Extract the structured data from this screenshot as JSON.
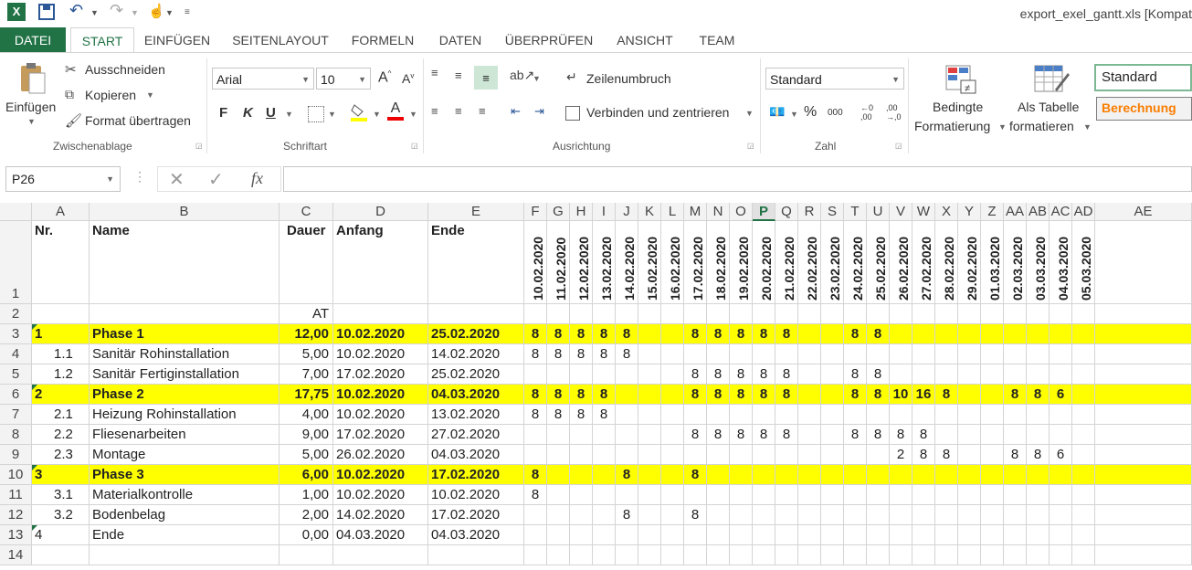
{
  "window": {
    "title": "export_exel_gantt.xls  [Kompat"
  },
  "quick_access": {
    "icons": [
      "excel-logo-icon",
      "save-icon",
      "undo-icon",
      "redo-icon",
      "touch-mode-icon",
      "customize-icon"
    ]
  },
  "tabs": [
    {
      "label": "DATEI"
    },
    {
      "label": "START"
    },
    {
      "label": "EINFÜGEN"
    },
    {
      "label": "SEITENLAYOUT"
    },
    {
      "label": "FORMELN"
    },
    {
      "label": "DATEN"
    },
    {
      "label": "ÜBERPRÜFEN"
    },
    {
      "label": "ANSICHT"
    },
    {
      "label": "TEAM"
    }
  ],
  "ribbon": {
    "clipboard": {
      "paste_label": "Einfügen",
      "cut_label": "Ausschneiden",
      "copy_label": "Kopieren",
      "format_painter_label": "Format übertragen",
      "group_label": "Zwischenablage"
    },
    "font": {
      "font_name": "Arial",
      "font_size": "10",
      "bold_label": "F",
      "italic_label": "K",
      "underline_label": "U",
      "group_label": "Schriftart"
    },
    "alignment": {
      "wrap_label": "Zeilenumbruch",
      "merge_label": "Verbinden und zentrieren",
      "group_label": "Ausrichtung"
    },
    "number": {
      "format": "Standard",
      "group_label": "Zahl"
    },
    "styles": {
      "conditional_label_1": "Bedingte",
      "conditional_label_2": "Formatierung",
      "table_label_1": "Als Tabelle",
      "table_label_2": "formatieren",
      "style_standard": "Standard",
      "style_calc": "Berechnung"
    }
  },
  "formula_bar": {
    "name_box": "P26",
    "fx": "fx",
    "formula": ""
  },
  "columns": [
    "A",
    "B",
    "C",
    "D",
    "E",
    "F",
    "G",
    "H",
    "I",
    "J",
    "K",
    "L",
    "M",
    "N",
    "O",
    "P",
    "Q",
    "R",
    "S",
    "T",
    "U",
    "V",
    "W",
    "X",
    "Y",
    "Z",
    "AA",
    "AB",
    "AC",
    "AD",
    "AE"
  ],
  "selected_column": "P",
  "headers": {
    "nr": "Nr.",
    "name": "Name",
    "dauer": "Dauer",
    "anfang": "Anfang",
    "ende": "Ende",
    "unit": "AT",
    "dates": [
      "10.02.2020",
      "11.02.2020",
      "12.02.2020",
      "13.02.2020",
      "14.02.2020",
      "15.02.2020",
      "16.02.2020",
      "17.02.2020",
      "18.02.2020",
      "19.02.2020",
      "20.02.2020",
      "21.02.2020",
      "22.02.2020",
      "23.02.2020",
      "24.02.2020",
      "25.02.2020",
      "26.02.2020",
      "27.02.2020",
      "28.02.2020",
      "29.02.2020",
      "01.03.2020",
      "02.03.2020",
      "03.03.2020",
      "04.03.2020",
      "05.03.2020"
    ]
  },
  "rows": [
    {
      "num": "3",
      "nr": "1",
      "name": "Phase 1",
      "dauer": "12,00",
      "anfang": "10.02.2020",
      "ende": "25.02.2020",
      "phase": true,
      "hours": [
        "8",
        "8",
        "8",
        "8",
        "8",
        "",
        "",
        "8",
        "8",
        "8",
        "8",
        "8",
        "",
        "",
        "8",
        "8",
        "",
        "",
        "",
        "",
        "",
        "",
        "",
        "",
        ""
      ]
    },
    {
      "num": "4",
      "nr": "1.1",
      "name": "Sanitär Rohinstallation",
      "dauer": "5,00",
      "anfang": "10.02.2020",
      "ende": "14.02.2020",
      "phase": false,
      "hours": [
        "8",
        "8",
        "8",
        "8",
        "8",
        "",
        "",
        "",
        "",
        "",
        "",
        "",
        "",
        "",
        "",
        "",
        "",
        "",
        "",
        "",
        "",
        "",
        "",
        "",
        ""
      ]
    },
    {
      "num": "5",
      "nr": "1.2",
      "name": "Sanitär Fertiginstallation",
      "dauer": "7,00",
      "anfang": "17.02.2020",
      "ende": "25.02.2020",
      "phase": false,
      "hours": [
        "",
        "",
        "",
        "",
        "",
        "",
        "",
        "8",
        "8",
        "8",
        "8",
        "8",
        "",
        "",
        "8",
        "8",
        "",
        "",
        "",
        "",
        "",
        "",
        "",
        "",
        ""
      ]
    },
    {
      "num": "6",
      "nr": "2",
      "name": "Phase 2",
      "dauer": "17,75",
      "anfang": "10.02.2020",
      "ende": "04.03.2020",
      "phase": true,
      "hours": [
        "8",
        "8",
        "8",
        "8",
        "",
        "",
        "",
        "8",
        "8",
        "8",
        "8",
        "8",
        "",
        "",
        "8",
        "8",
        "10",
        "16",
        "8",
        "",
        "",
        "8",
        "8",
        "6",
        ""
      ]
    },
    {
      "num": "7",
      "nr": "2.1",
      "name": "Heizung Rohinstallation",
      "dauer": "4,00",
      "anfang": "10.02.2020",
      "ende": "13.02.2020",
      "phase": false,
      "hours": [
        "8",
        "8",
        "8",
        "8",
        "",
        "",
        "",
        "",
        "",
        "",
        "",
        "",
        "",
        "",
        "",
        "",
        "",
        "",
        "",
        "",
        "",
        "",
        "",
        "",
        ""
      ]
    },
    {
      "num": "8",
      "nr": "2.2",
      "name": "Fliesenarbeiten",
      "dauer": "9,00",
      "anfang": "17.02.2020",
      "ende": "27.02.2020",
      "phase": false,
      "hours": [
        "",
        "",
        "",
        "",
        "",
        "",
        "",
        "8",
        "8",
        "8",
        "8",
        "8",
        "",
        "",
        "8",
        "8",
        "8",
        "8",
        "",
        "",
        "",
        "",
        "",
        "",
        ""
      ]
    },
    {
      "num": "9",
      "nr": "2.3",
      "name": "Montage",
      "dauer": "5,00",
      "anfang": "26.02.2020",
      "ende": "04.03.2020",
      "phase": false,
      "hours": [
        "",
        "",
        "",
        "",
        "",
        "",
        "",
        "",
        "",
        "",
        "",
        "",
        "",
        "",
        "",
        "",
        "2",
        "8",
        "8",
        "",
        "",
        "8",
        "8",
        "6",
        ""
      ]
    },
    {
      "num": "10",
      "nr": "3",
      "name": "Phase 3",
      "dauer": "6,00",
      "anfang": "10.02.2020",
      "ende": "17.02.2020",
      "phase": true,
      "hours": [
        "8",
        "",
        "",
        "",
        "8",
        "",
        "",
        "8",
        "",
        "",
        "",
        "",
        "",
        "",
        "",
        "",
        "",
        "",
        "",
        "",
        "",
        "",
        "",
        "",
        ""
      ]
    },
    {
      "num": "11",
      "nr": "3.1",
      "name": "Materialkontrolle",
      "dauer": "1,00",
      "anfang": "10.02.2020",
      "ende": "10.02.2020",
      "phase": false,
      "hours": [
        "8",
        "",
        "",
        "",
        "",
        "",
        "",
        "",
        "",
        "",
        "",
        "",
        "",
        "",
        "",
        "",
        "",
        "",
        "",
        "",
        "",
        "",
        "",
        "",
        ""
      ]
    },
    {
      "num": "12",
      "nr": "3.2",
      "name": "Bodenbelag",
      "dauer": "2,00",
      "anfang": "14.02.2020",
      "ende": "17.02.2020",
      "phase": false,
      "hours": [
        "",
        "",
        "",
        "",
        "8",
        "",
        "",
        "8",
        "",
        "",
        "",
        "",
        "",
        "",
        "",
        "",
        "",
        "",
        "",
        "",
        "",
        "",
        "",
        "",
        ""
      ]
    },
    {
      "num": "13",
      "nr": "4",
      "name": "Ende",
      "dauer": "0,00",
      "anfang": "04.03.2020",
      "ende": "04.03.2020",
      "phase": false,
      "hours": [
        "",
        "",
        "",
        "",
        "",
        "",
        "",
        "",
        "",
        "",
        "",
        "",
        "",
        "",
        "",
        "",
        "",
        "",
        "",
        "",
        "",
        "",
        "",
        "",
        ""
      ]
    },
    {
      "num": "14",
      "nr": "",
      "name": "",
      "dauer": "",
      "anfang": "",
      "ende": "",
      "phase": false,
      "hours": [
        "",
        "",
        "",
        "",
        "",
        "",
        "",
        "",
        "",
        "",
        "",
        "",
        "",
        "",
        "",
        "",
        "",
        "",
        "",
        "",
        "",
        "",
        "",
        "",
        ""
      ]
    }
  ],
  "row_numbers_top": [
    "1",
    "2"
  ],
  "colors": {
    "accent": "#217346",
    "phase_fill": "#ffff00",
    "calc_style": "#fa7d00"
  }
}
